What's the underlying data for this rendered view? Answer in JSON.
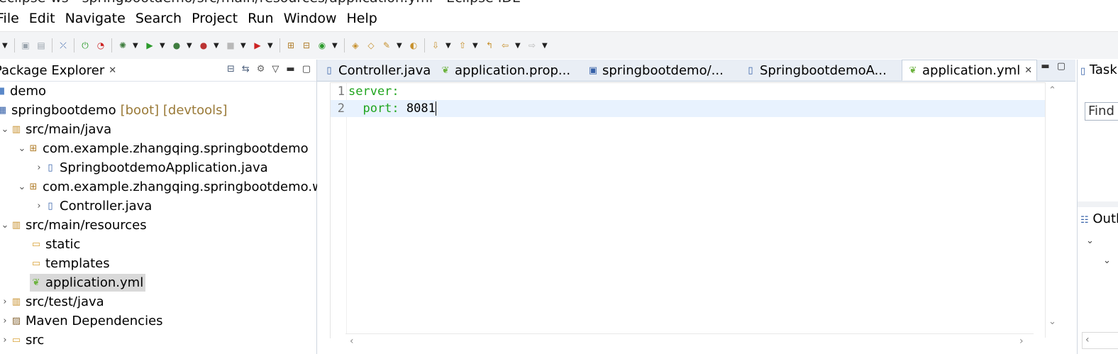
{
  "window": {
    "title": "eclipse-ws - springbootdemo/src/main/resources/application.yml - Eclipse IDE"
  },
  "menu": [
    "File",
    "Edit",
    "Navigate",
    "Search",
    "Project",
    "Run",
    "Window",
    "Help"
  ],
  "package_explorer": {
    "title": "Package Explorer",
    "items": [
      {
        "label": "demo",
        "decor": ""
      },
      {
        "label": "springbootdemo",
        "decor": "[boot] [devtools]"
      },
      {
        "label": "src/main/java",
        "decor": ""
      },
      {
        "label": "com.example.zhangqing.springbootdemo",
        "decor": ""
      },
      {
        "label": "SpringbootdemoApplication.java",
        "decor": ""
      },
      {
        "label": "com.example.zhangqing.springbootdemo.web",
        "decor": ""
      },
      {
        "label": "Controller.java",
        "decor": ""
      },
      {
        "label": "src/main/resources",
        "decor": ""
      },
      {
        "label": "static",
        "decor": ""
      },
      {
        "label": "templates",
        "decor": ""
      },
      {
        "label": "application.yml",
        "decor": ""
      },
      {
        "label": "src/test/java",
        "decor": ""
      },
      {
        "label": "Maven Dependencies",
        "decor": ""
      },
      {
        "label": "src",
        "decor": ""
      }
    ]
  },
  "editor": {
    "tabs": [
      {
        "label": "Controller.java"
      },
      {
        "label": "application.prop..."
      },
      {
        "label": "springbootdemo/..."
      },
      {
        "label": "SpringbootdemoA..."
      },
      {
        "label": "application.yml",
        "active": true
      }
    ],
    "lines": [
      {
        "num": "1",
        "key": "server:",
        "value": ""
      },
      {
        "num": "2",
        "key": "  port: ",
        "value": "8081"
      }
    ]
  },
  "right_panels": {
    "task_tab": "Task List",
    "find_placeholder": "Find",
    "outline_tab": "Outline"
  },
  "colors": {
    "yaml_key": "#20a51e",
    "current_line": "#e8f2fe",
    "tab_bar": "#e9eef5"
  }
}
